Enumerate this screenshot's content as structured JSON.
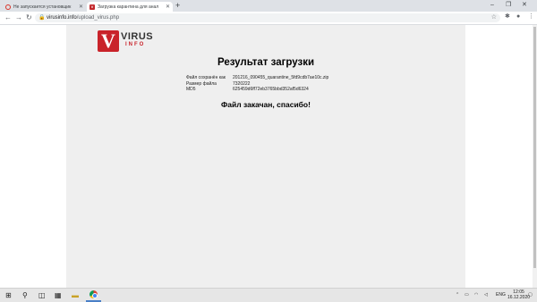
{
  "browser": {
    "tabs": [
      {
        "title": "Не запускается установщик",
        "active": false
      },
      {
        "title": "Загрузка карантина для анал",
        "active": true
      }
    ],
    "url_host": "virusinfo.info",
    "url_path": "/upload_virus.php"
  },
  "page": {
    "logo": {
      "mark": "V",
      "word1": "VIRUS",
      "word2": "INFO"
    },
    "heading": "Результат загрузки",
    "info": [
      {
        "label": "Файл сохранён как",
        "value": "201216_090455_quarantine_5fd9cdb7ae10c.zip"
      },
      {
        "label": "Размер файла",
        "value": "7320222"
      },
      {
        "label": "MD5",
        "value": "625459d6ff72eb3765bbd352af5d6324"
      }
    ],
    "done_message": "Файл закачан, спасибо!"
  },
  "taskbar": {
    "lang": "ENG",
    "time": "12:05",
    "date": "16.12.2020"
  },
  "colors": {
    "brand_red": "#c9232a",
    "page_bg": "#efefef"
  }
}
